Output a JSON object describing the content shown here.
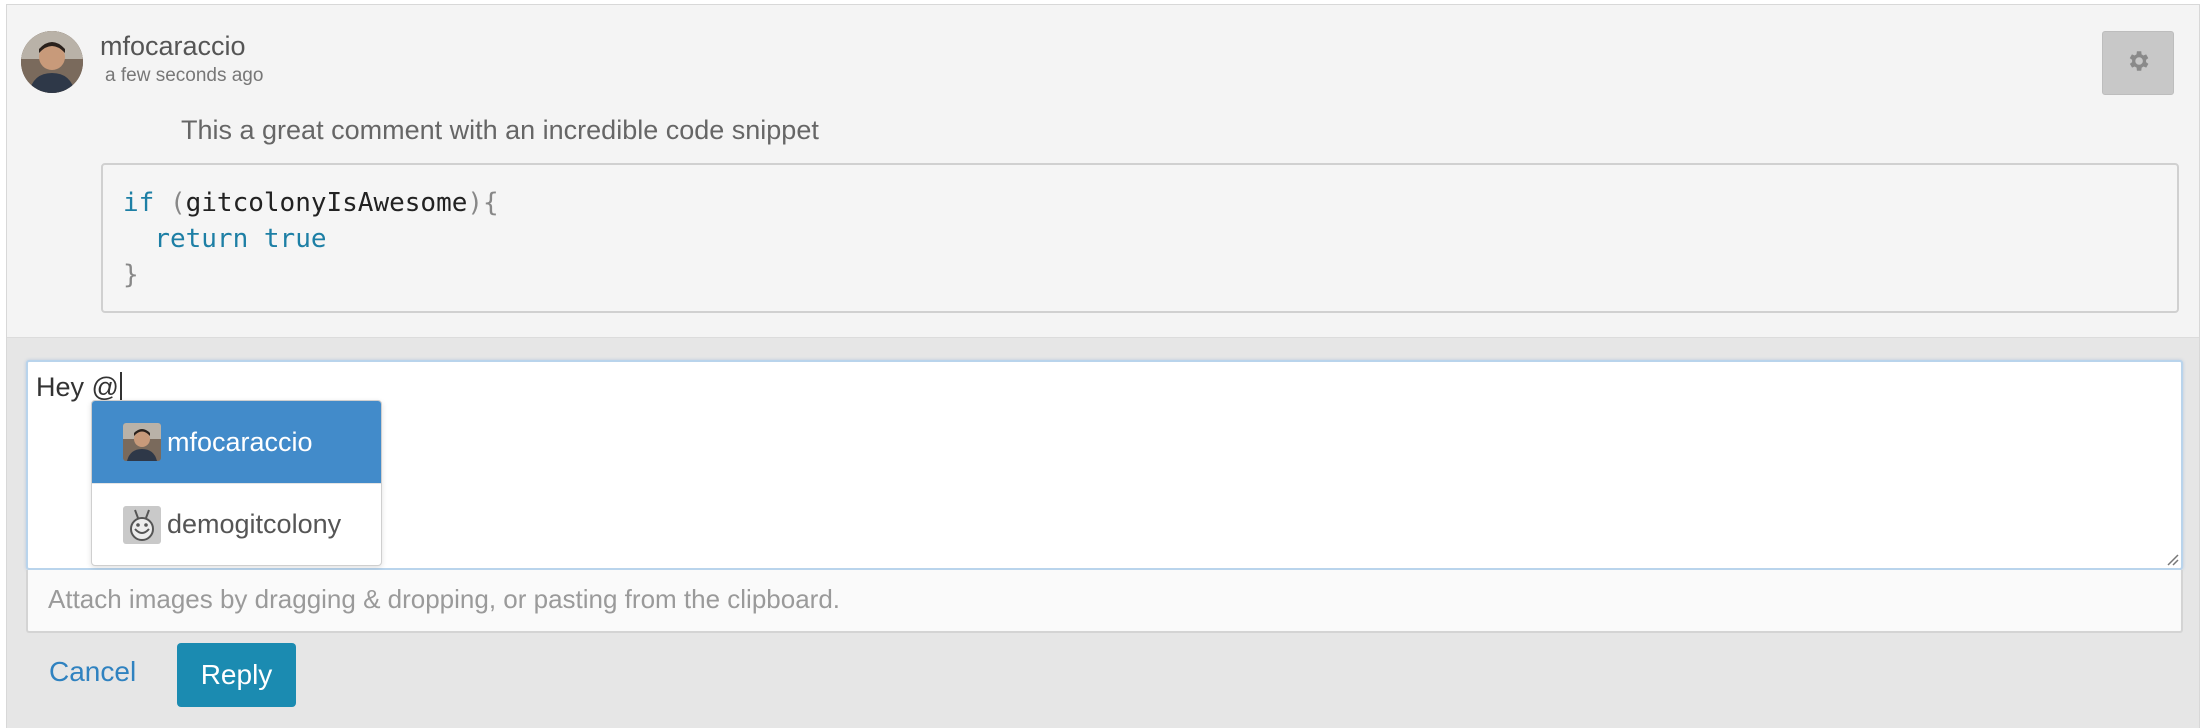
{
  "comment": {
    "author": "mfocaraccio",
    "timestamp": "a few seconds ago",
    "text": "This a great comment with an incredible code snippet",
    "settings_icon": "gear-icon",
    "code": {
      "line1_kw": "if",
      "line1_open": "(",
      "line1_ident": "gitcolonyIsAwesome",
      "line1_close": "){",
      "line2_kw1": "return",
      "line2_kw2": "true",
      "line3": "}"
    }
  },
  "reply": {
    "value": "Hey @",
    "mentions": [
      {
        "username": "mfocaraccio",
        "selected": true
      },
      {
        "username": "demogitcolony",
        "selected": false
      }
    ],
    "attach_hint": "Attach images by dragging & dropping, or pasting from the clipboard.",
    "cancel_label": "Cancel",
    "reply_label": "Reply"
  },
  "colors": {
    "accent": "#428bca",
    "reply_button": "#1b8bb1",
    "link": "#2f82c0",
    "keyword": "#1d7fa5"
  }
}
